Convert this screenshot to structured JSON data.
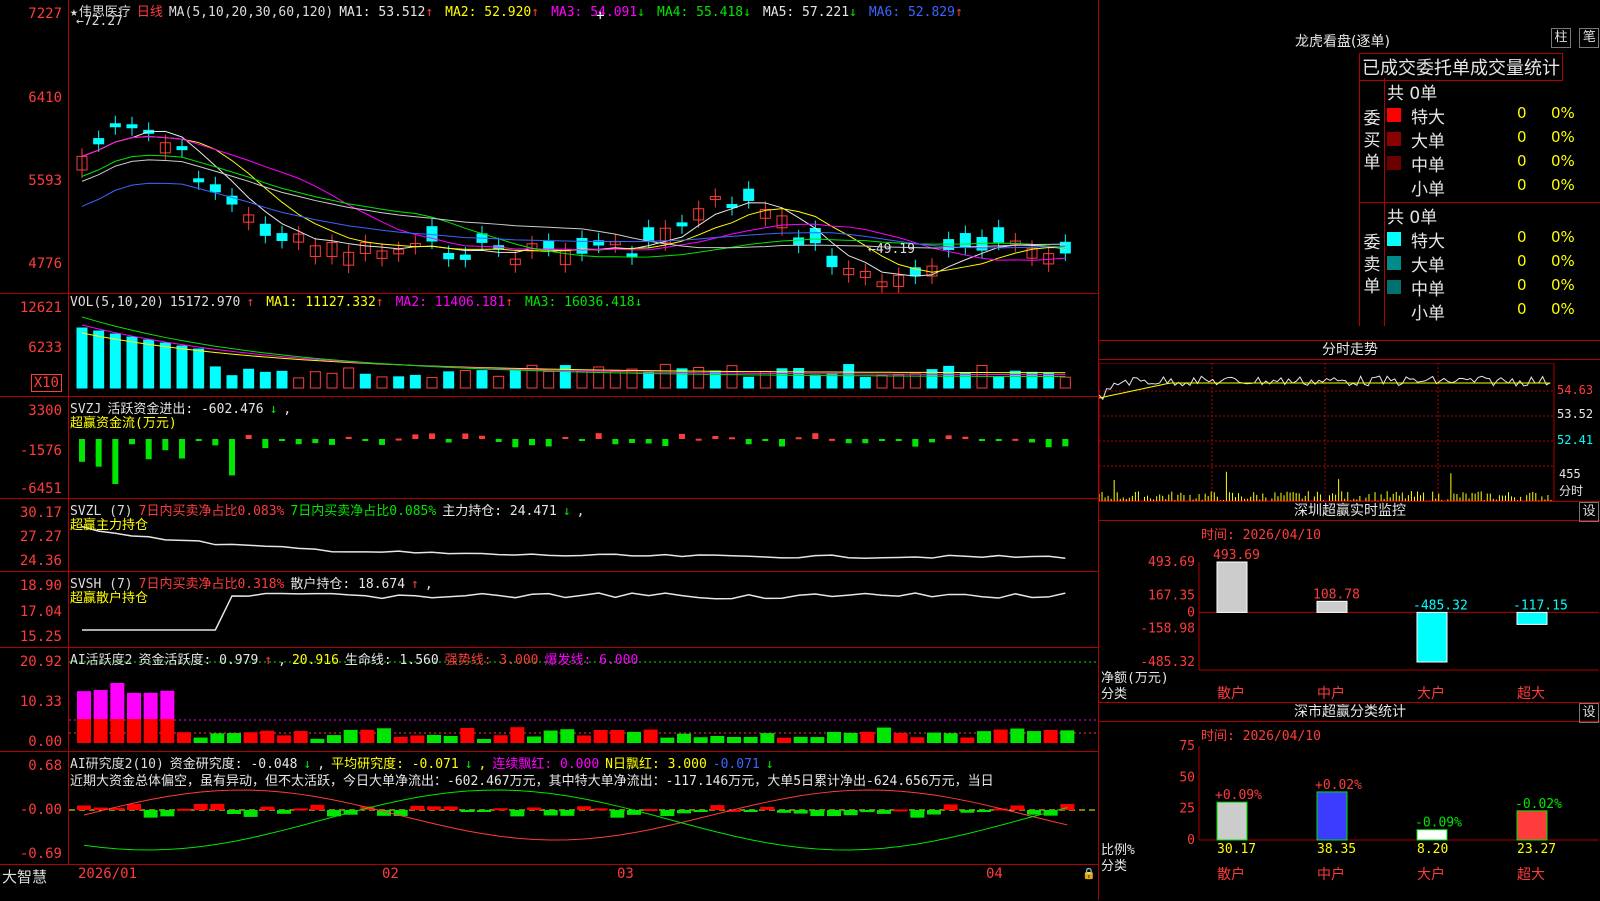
{
  "app_name": "大智慧",
  "main": {
    "stock_name": "伟思医疗",
    "period": "日线",
    "ma_label": "MA(5,10,20,30,60,120)",
    "ma": [
      {
        "text": "MA1: 53.512",
        "arrow": "↑",
        "color": "#e6e6e6"
      },
      {
        "text": "MA2: 52.920",
        "arrow": "↑",
        "color": "#ffff00"
      },
      {
        "text": "MA3: 54.091",
        "arrow": "↓",
        "color": "#ff00ff"
      },
      {
        "text": "MA4: 55.418",
        "arrow": "↓",
        "color": "#00e600"
      },
      {
        "text": "MA5: 57.221",
        "arrow": "↓",
        "color": "#e6e6e6"
      },
      {
        "text": "MA6: 52.829",
        "arrow": "↑",
        "color": "#3c64ff"
      }
    ],
    "yaxis": [
      "7227",
      "6410",
      "5593",
      "4776"
    ],
    "high_mark": "72.27",
    "low_mark": "49.19"
  },
  "vol": {
    "label": "VOL(5,10,20)",
    "value": "15172.970",
    "value_arrow": "↑",
    "ma": [
      {
        "text": "MA1: 11127.332",
        "arrow": "↑",
        "color": "#ffff00"
      },
      {
        "text": "MA2: 11406.181",
        "arrow": "↑",
        "color": "#ff00ff"
      },
      {
        "text": "MA3: 16036.418",
        "arrow": "↓",
        "color": "#00e600"
      }
    ],
    "yaxis": [
      "12621",
      "6233"
    ],
    "multiplier": "X10"
  },
  "svzj": {
    "label": "SVZJ",
    "line1": "活跃资金进出: -602.476",
    "line1_arrow": "↓",
    "subtitle": "超赢资金流(万元)",
    "yaxis": [
      "3300",
      "-1576",
      "-6451"
    ]
  },
  "svzl": {
    "label": "SVZL (7)",
    "red_text": "7日内买卖净占比0.083%",
    "green_text": "7日内买卖净占比0.085%",
    "white_text": "主力持仓: 24.471",
    "white_arrow": "↓",
    "subtitle": "超赢主力持仓",
    "yaxis": [
      "30.17",
      "27.27",
      "24.36"
    ]
  },
  "svsh": {
    "label": "SVSH (7)",
    "red_text": "7日内买卖净占比0.318%",
    "white_text": "散户持仓: 18.674",
    "white_arrow": "↑",
    "subtitle": "超赢散户持仓",
    "yaxis": [
      "18.90",
      "17.04",
      "15.25"
    ]
  },
  "ai_active": {
    "label": "AI活跃度2",
    "t1": "资金活跃度: 0.979",
    "t1_arrow": "↑",
    "t2": "20.916",
    "t3": "生命线: 1.560",
    "t4": "强势线: 3.000",
    "t5": "爆发线: 6.000",
    "yaxis": [
      "20.92",
      "10.33",
      "0.00"
    ]
  },
  "ai_research": {
    "label": "AI研究度2(10)",
    "t1": "资金研究度: -0.048",
    "t1_arrow": "↓",
    "t2": "平均研究度: -0.071",
    "t2_arrow": "↓",
    "t3": "连续飘红: 0.000",
    "t4": "N日飘红: 3.000",
    "t5": "-0.071",
    "t5_arrow": "↓",
    "summary": "近期大资金总体偏空，虽有异动，但不太活跃，今日大单净流出：-602.467万元，其中特大单净流出：-117.146万元，大单5日累计净出-624.656万元，当日",
    "yaxis": [
      "0.68",
      "-0.00",
      "-0.69"
    ]
  },
  "xaxis": [
    "2026/01",
    "02",
    "03",
    "04"
  ],
  "dragon": {
    "title": "龙虎看盘(逐单)",
    "btn1": "柱",
    "btn2": "笔",
    "subtitle": "已成交委托单成交量统计",
    "buy": {
      "label_chars": [
        "委",
        "买",
        "单"
      ],
      "total": "共 0单",
      "rows": [
        {
          "name": "特大",
          "v": "0",
          "p": "0%",
          "color": "#ff0000"
        },
        {
          "name": "大单",
          "v": "0",
          "p": "0%",
          "color": "#8b0000"
        },
        {
          "name": "中单",
          "v": "0",
          "p": "0%",
          "color": "#6a0000"
        },
        {
          "name": "小单",
          "v": "0",
          "p": "0%",
          "color": "#000000"
        }
      ]
    },
    "sell": {
      "label_chars": [
        "委",
        "卖",
        "单"
      ],
      "total": "共 0单",
      "rows": [
        {
          "name": "特大",
          "v": "0",
          "p": "0%",
          "color": "#00ffff"
        },
        {
          "name": "大单",
          "v": "0",
          "p": "0%",
          "color": "#008b8b"
        },
        {
          "name": "中单",
          "v": "0",
          "p": "0%",
          "color": "#007070"
        },
        {
          "name": "小单",
          "v": "0",
          "p": "0%",
          "color": "#000000"
        }
      ]
    }
  },
  "intraday": {
    "title": "分时走势",
    "yaxis": [
      "54.63",
      "53.52",
      "52.41"
    ],
    "vol_label": "455",
    "vol_unit": "分时"
  },
  "sz_monitor": {
    "title": "深圳超赢实时监控",
    "set_btn": "设",
    "time": "时间: 2026/04/10",
    "yaxis": [
      "493.69",
      "167.35",
      "0",
      "-158.98",
      "-485.32"
    ],
    "ylabel": "净额(万元)",
    "xlabel": "分类",
    "bars": [
      {
        "cat": "散户",
        "value": "493.69"
      },
      {
        "cat": "中户",
        "value": "108.78"
      },
      {
        "cat": "大户",
        "value": "-485.32"
      },
      {
        "cat": "超大",
        "value": "-117.15"
      }
    ]
  },
  "sz_class": {
    "title": "深市超赢分类统计",
    "set_btn": "设",
    "time": "时间: 2026/04/10",
    "yaxis": [
      "75",
      "50",
      "25",
      "0"
    ],
    "ylabel": "比例%",
    "xlabel": "分类",
    "bars": [
      {
        "cat": "散户",
        "pct": "30.17",
        "change": "+0.09%"
      },
      {
        "cat": "中户",
        "pct": "38.35",
        "change": "+0.02%"
      },
      {
        "cat": "大户",
        "pct": "8.20",
        "change": "-0.09%"
      },
      {
        "cat": "超大",
        "pct": "23.27",
        "change": "-0.02%"
      }
    ]
  },
  "chart_data": [
    {
      "type": "bar",
      "title": "深圳超赢实时监控",
      "ylabel": "净额(万元)",
      "xlabel": "分类",
      "categories": [
        "散户",
        "中户",
        "大户",
        "超大"
      ],
      "values": [
        493.69,
        108.78,
        -485.32,
        -117.15
      ],
      "ylim": [
        -485.32,
        493.69
      ]
    },
    {
      "type": "bar",
      "title": "深市超赢分类统计",
      "ylabel": "比例%",
      "xlabel": "分类",
      "categories": [
        "散户",
        "中户",
        "大户",
        "超大"
      ],
      "values": [
        30.17,
        38.35,
        8.2,
        23.27
      ],
      "ylim": [
        0,
        75
      ]
    }
  ]
}
